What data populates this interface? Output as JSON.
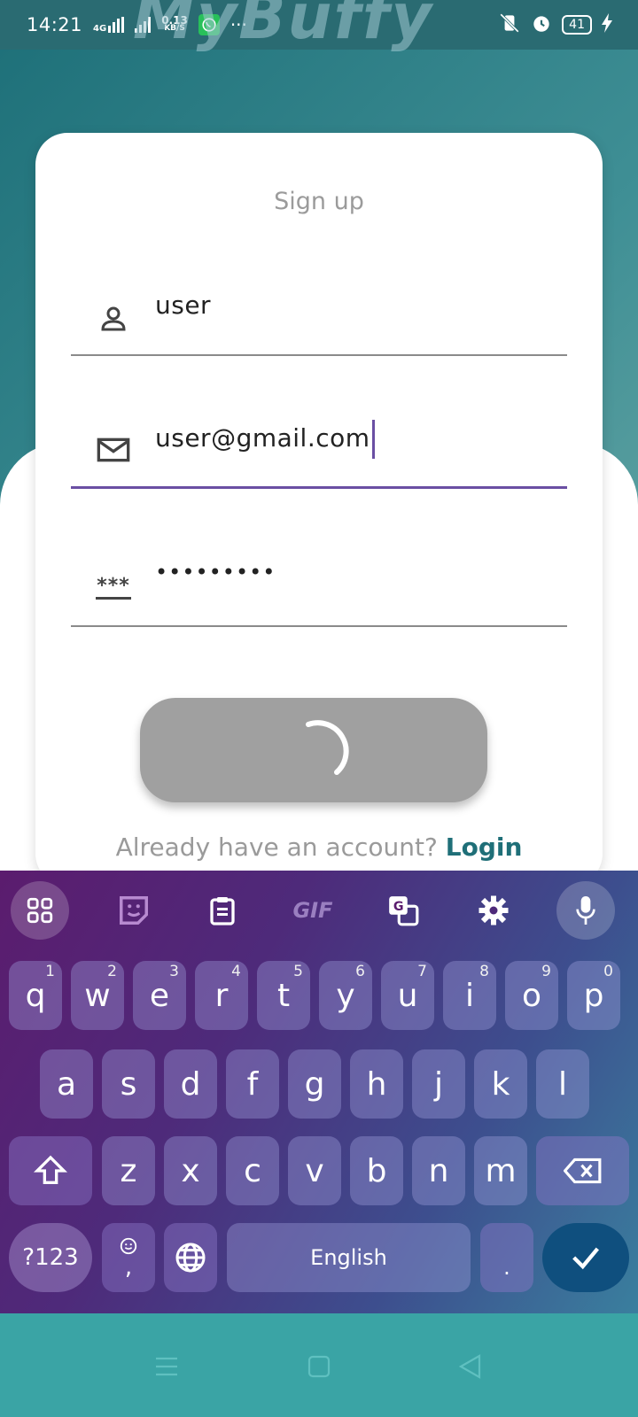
{
  "status_bar": {
    "time": "14:21",
    "network_label": "4G",
    "speed_value": "0.13",
    "speed_unit": "KB/S",
    "more": "···",
    "battery": "41"
  },
  "watermark": "MyBuffy",
  "form": {
    "title": "Sign up",
    "username_value": "user",
    "email_value": "user@gmail.com",
    "password_value": "•••••••••",
    "password_icon_text": "***",
    "login_prompt": "Already have an account?",
    "login_link": "Login"
  },
  "keyboard": {
    "toolbar": {
      "gif_label": "GIF"
    },
    "row1": [
      {
        "key": "q",
        "hint": "1"
      },
      {
        "key": "w",
        "hint": "2"
      },
      {
        "key": "e",
        "hint": "3"
      },
      {
        "key": "r",
        "hint": "4"
      },
      {
        "key": "t",
        "hint": "5"
      },
      {
        "key": "y",
        "hint": "6"
      },
      {
        "key": "u",
        "hint": "7"
      },
      {
        "key": "i",
        "hint": "8"
      },
      {
        "key": "o",
        "hint": "9"
      },
      {
        "key": "p",
        "hint": "0"
      }
    ],
    "row2": [
      "a",
      "s",
      "d",
      "f",
      "g",
      "h",
      "j",
      "k",
      "l"
    ],
    "row3": [
      "z",
      "x",
      "c",
      "v",
      "b",
      "n",
      "m"
    ],
    "num_key": "?123",
    "comma_key": ",",
    "space_label": "English",
    "period_key": "."
  },
  "colors": {
    "accent": "#6a4fa3",
    "link": "#1f6f78",
    "enter_key": "#0f4f7e",
    "navbar": "#3aa4a5"
  }
}
